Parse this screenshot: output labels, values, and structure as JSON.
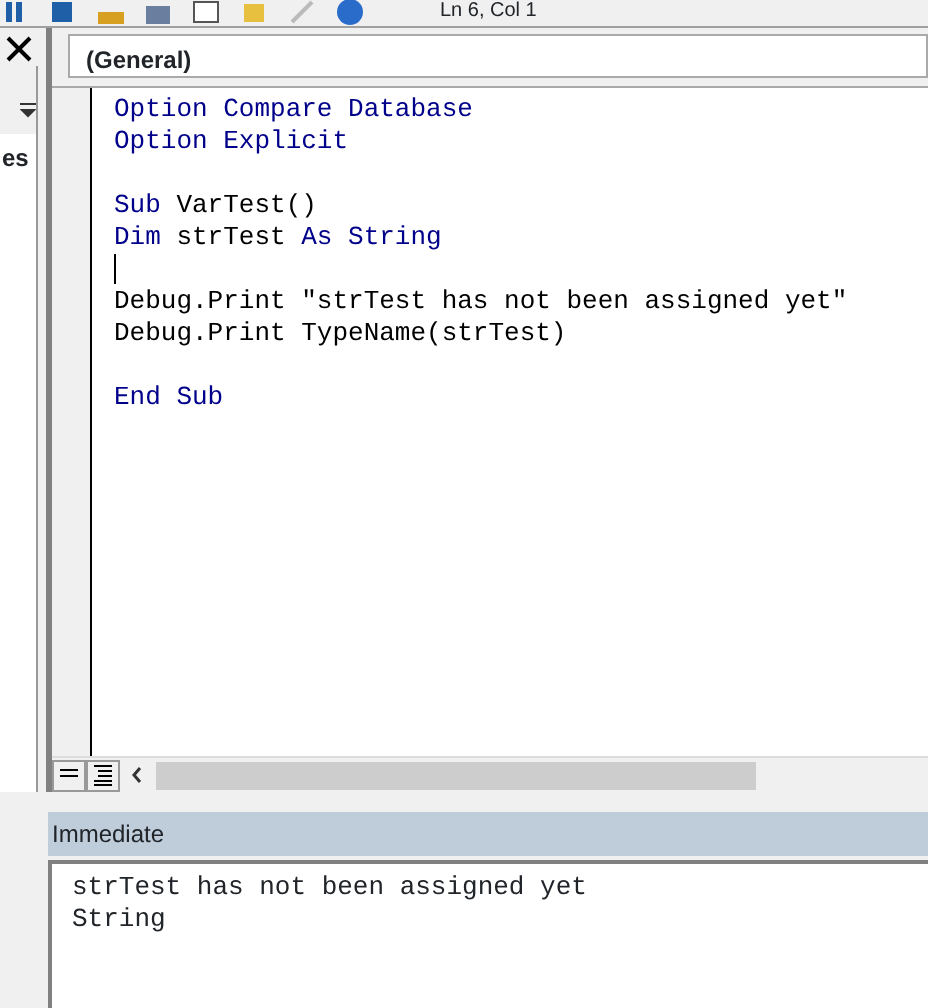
{
  "toolbar": {
    "position": "Ln 6, Col 1"
  },
  "project_pane": {
    "item_text": "es"
  },
  "code_window": {
    "object_combo": "(General)",
    "lines": [
      [
        {
          "text": "Option Compare Database",
          "keyword": true
        }
      ],
      [
        {
          "text": "Option Explicit",
          "keyword": true
        }
      ],
      {
        "kind": "blank"
      },
      [
        {
          "text": "Sub",
          "keyword": true
        },
        {
          "text": " VarTest()",
          "keyword": false
        }
      ],
      [
        {
          "text": "Dim",
          "keyword": true
        },
        {
          "text": " strTest ",
          "keyword": false
        },
        {
          "text": "As String",
          "keyword": true
        }
      ],
      {
        "kind": "cursor"
      },
      [
        {
          "text": "Debug.Print \"strTest has not been assigned yet\"",
          "keyword": false
        }
      ],
      [
        {
          "text": "Debug.Print TypeName(strTest)",
          "keyword": false
        }
      ],
      {
        "kind": "blank"
      },
      [
        {
          "text": "End Sub",
          "keyword": true
        }
      ]
    ]
  },
  "immediate": {
    "title": "Immediate",
    "lines": [
      "strTest has not been assigned yet",
      "String"
    ]
  }
}
